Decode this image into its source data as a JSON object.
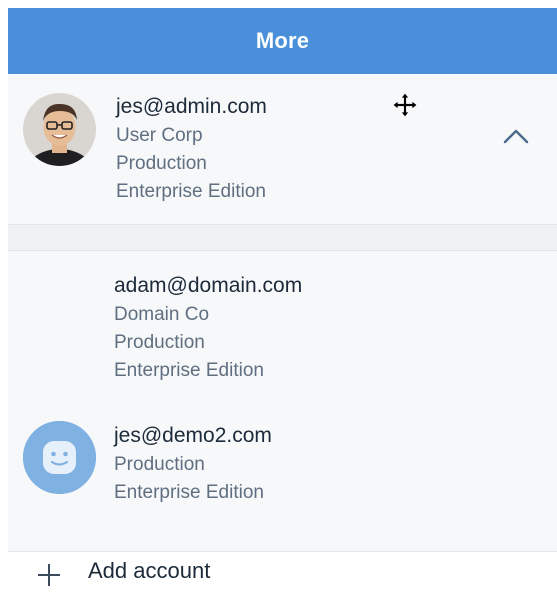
{
  "header": {
    "title": "More"
  },
  "accounts": [
    {
      "email": "jes@admin.com",
      "org": "User Corp",
      "environment": "Production",
      "edition": "Enterprise Edition",
      "avatar": "photo",
      "expanded": true,
      "indicator_icon": "chevron-up-icon"
    },
    {
      "email": "adam@domain.com",
      "org": "Domain Co",
      "environment": "Production",
      "edition": "Enterprise Edition",
      "avatar": "none"
    },
    {
      "email": "jes@demo2.com",
      "environment": "Production",
      "edition": "Enterprise Edition",
      "avatar": "smiley-placeholder"
    }
  ],
  "add_account": {
    "label": "Add account",
    "icon": "plus-icon"
  },
  "colors": {
    "header_bg": "#4a8fd9",
    "header_text": "#ffffff",
    "panel_bg": "#f7f8fa",
    "primary_text": "#1c2a3a",
    "secondary_text": "#5f6f80",
    "placeholder_avatar": "#7fb1e2",
    "chevron": "#4b6a8a"
  }
}
